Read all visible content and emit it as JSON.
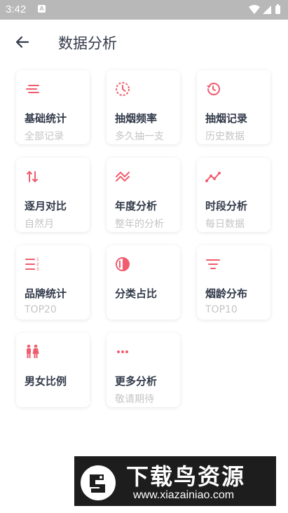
{
  "status_bar": {
    "time": "3:42",
    "app_badge": "A"
  },
  "header": {
    "title": "数据分析"
  },
  "colors": {
    "accent": "#ef5d6e",
    "label": "#323a4a",
    "sub": "#c4c4c4"
  },
  "cards": [
    {
      "label": "基础统计",
      "sub": "全部记录",
      "icon": "lines-icon"
    },
    {
      "label": "抽烟频率",
      "sub": "多久抽一支",
      "icon": "clock-icon"
    },
    {
      "label": "抽烟记录",
      "sub": "历史数据",
      "icon": "history-icon"
    },
    {
      "label": "逐月对比",
      "sub": "自然月",
      "icon": "swap-arrows-icon"
    },
    {
      "label": "年度分析",
      "sub": "整年的分析",
      "icon": "double-chevron-icon"
    },
    {
      "label": "时段分析",
      "sub": "每日数据",
      "icon": "trend-line-icon"
    },
    {
      "label": "品牌统计",
      "sub": "TOP20",
      "icon": "numbered-list-icon"
    },
    {
      "label": "分类占比",
      "sub": "",
      "icon": "contrast-circle-icon"
    },
    {
      "label": "烟龄分布",
      "sub": "TOP10",
      "icon": "filter-icon"
    },
    {
      "label": "男女比例",
      "sub": "",
      "icon": "people-icon"
    },
    {
      "label": "更多分析",
      "sub": "敬请期待",
      "icon": "more-dots-icon"
    }
  ],
  "watermark": {
    "title": "下载鸟资源",
    "url": "www.xiazainiao.com"
  }
}
